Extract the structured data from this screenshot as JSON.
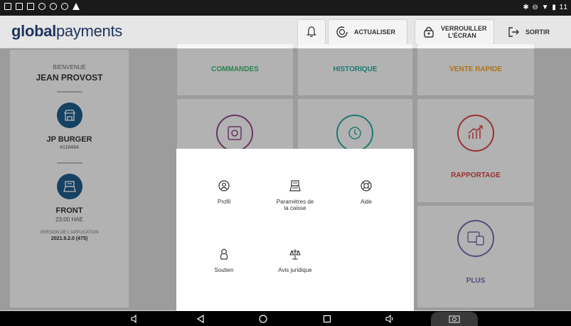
{
  "status_bar": {
    "right_text": "✱ ⊖ ▼ ▮ 11"
  },
  "header": {
    "logo_bold": "global",
    "logo_light": "payments",
    "refresh_label": "ACTUALISER",
    "lock_label_line1": "VERROUILLER",
    "lock_label_line2": "L'ÉCRAN",
    "exit_label": "SORTIR"
  },
  "sidebar": {
    "welcome": "BIENVENUE",
    "user_name": "JEAN PROVOST",
    "store_name": "JP BURGER",
    "store_id": "#116484",
    "register_name": "FRONT",
    "register_time": "23:00 HAE",
    "version_label": "VERSION DE L'APPLICATION",
    "version_value": "2021.9.2.0 (475)"
  },
  "tiles": {
    "commandes": "COMMANDES",
    "historique": "HISTORIQUE",
    "vente_rapide": "VENTE RAPIDE",
    "rapportage": "RAPPORTAGE",
    "plus": "PLUS"
  },
  "colors": {
    "brand": "#1f3560",
    "commandes": "#3cb371",
    "historique": "#29a89b",
    "vente_rapide": "#f0a020",
    "rapportage": "#d64545",
    "vault": "#8e4a8a",
    "plus": "#7a6aa8",
    "sidebar_circle": "#1e5a8a"
  },
  "dialog": {
    "options": [
      {
        "label": "Profil",
        "icon": "user-icon"
      },
      {
        "label": "Paramètres de la caisse",
        "icon": "register-icon"
      },
      {
        "label": "Aide",
        "icon": "lifebuoy-icon"
      },
      {
        "label": "Soutien",
        "icon": "support-icon"
      },
      {
        "label": "Avis juridique",
        "icon": "scales-icon"
      }
    ]
  }
}
